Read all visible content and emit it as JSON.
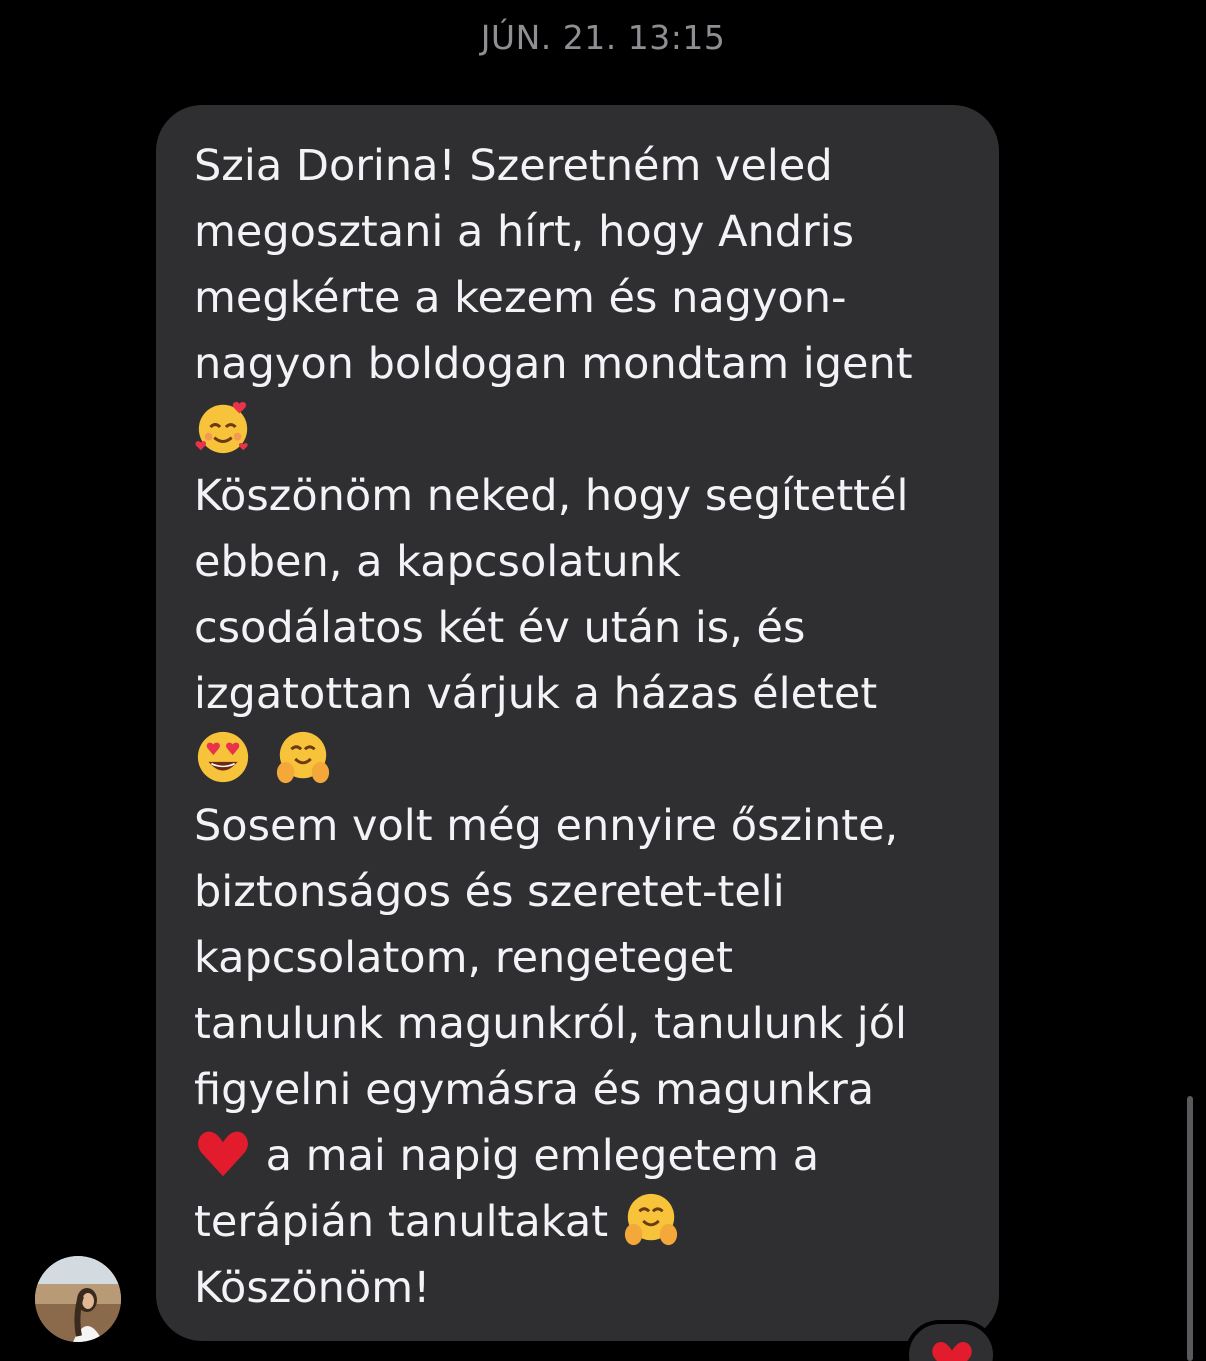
{
  "header": {
    "timestamp": "JÚN. 21. 13:15"
  },
  "message": {
    "lines": [
      "Szia Dorina! Szeretném veled",
      "megosztani a hírt, hogy Andris",
      "megkérte a kezem és nagyon-",
      "nagyon boldogan mondtam igent",
      "",
      "Köszönöm neked, hogy segítettél",
      "ebben, a kapcsolatunk",
      "csodálatos két év után is, és",
      "izgatottan várjuk a házas életet",
      "",
      "Sosem volt még ennyire őszinte,",
      "biztonságos és szeretet-teli",
      "kapcsolatom, rengeteget",
      "tanulunk magunkról, tanulunk jól",
      "figyelni egymásra és magunkra",
      " a mai napig emlegetem a",
      "terápián tanultakat ",
      "Köszönöm!"
    ],
    "emoji_icons": [
      "smiling-face-with-hearts-icon",
      "heart-eyes-icon",
      "hugging-face-icon",
      "red-heart-icon"
    ]
  },
  "reaction": {
    "icon": "red-heart-icon"
  },
  "colors": {
    "background": "#000000",
    "bubble": "#2f2f31",
    "text": "#f2f2f7",
    "timestamp": "#8e8e93"
  }
}
